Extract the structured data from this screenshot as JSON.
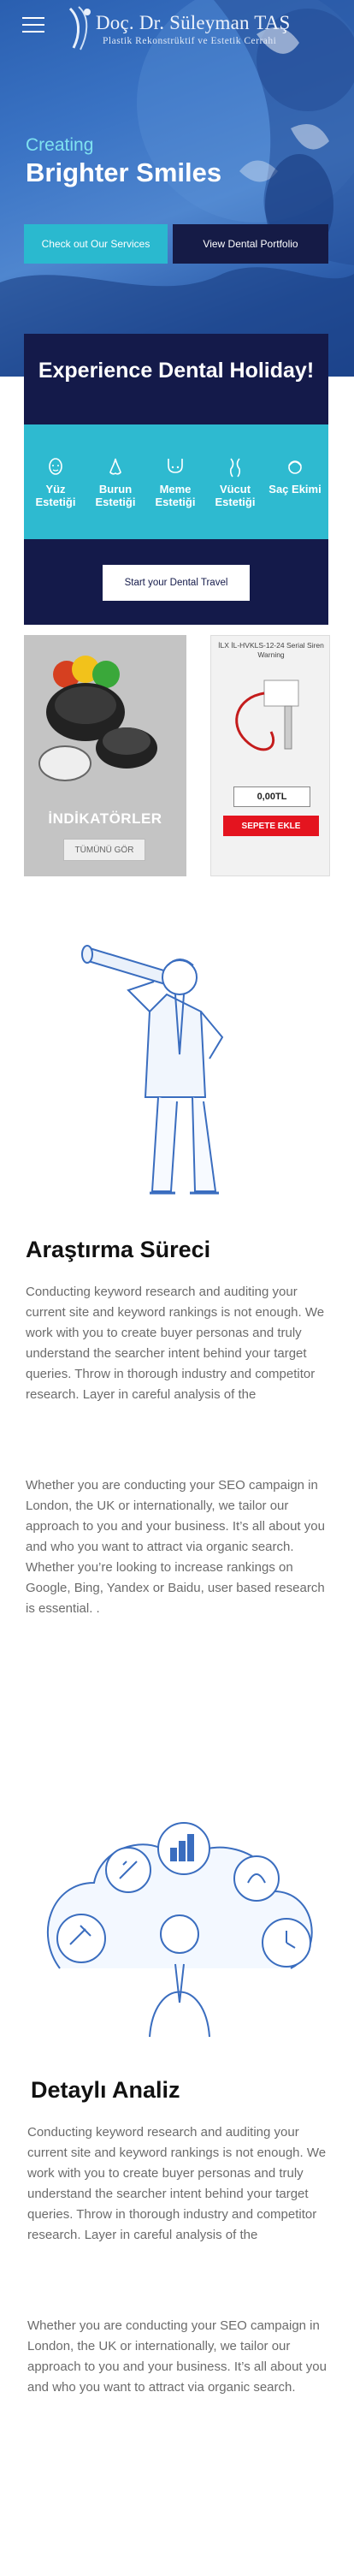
{
  "header": {
    "logo_name": "Doç. Dr. Süleyman TAŞ",
    "logo_subtitle": "Plastik Rekonstrüktif ve Estetik Cerrahi"
  },
  "hero": {
    "tagline_small": "Creating",
    "tagline_big": "Brighter Smiles",
    "btn_services": "Check out Our Services",
    "btn_portfolio": "View Dental Portfolio"
  },
  "holiday": {
    "title": "Experience Dental Holiday!",
    "services": [
      {
        "label": "Yüz Estetiği",
        "icon": "face-icon"
      },
      {
        "label": "Burun Estetiği",
        "icon": "nose-icon"
      },
      {
        "label": "Meme Estetiği",
        "icon": "breast-icon"
      },
      {
        "label": "Vücut Estetiği",
        "icon": "body-icon"
      },
      {
        "label": "Saç Ekimi",
        "icon": "hair-icon"
      }
    ],
    "btn_travel": "Start your Dental Travel"
  },
  "products": {
    "p1_label": "İNDİKATÖRLER",
    "p1_button": "TÜMÜNÜ GÖR",
    "p2_name": "İLX İL-HVKLS-12-24 Serial Siren Warning",
    "p2_price": "0,00TL",
    "p2_button": "SEPETE EKLE"
  },
  "section1": {
    "title": "Araştırma Süreci",
    "para1": "Conducting keyword research and auditing your current site and keyword rankings is not enough. We work with you to create buyer personas and truly understand the searcher intent behind your target queries. Throw in thorough industry and competitor research. Layer in careful analysis of the",
    "para2": "Whether you are conducting your SEO campaign in London, the UK or internationally, we tailor our approach to you and your business. It’s all about you and who you want to attract via organic search. Whether you’re looking to increase rankings on Google, Bing, Yandex or Baidu, user based research is essential. ."
  },
  "section2": {
    "title": "Detaylı Analiz",
    "para1": "Conducting keyword research and auditing your current site and keyword rankings is not enough. We work with you to create buyer personas and truly understand the searcher intent behind your target queries. Throw in thorough industry and competitor research. Layer in careful analysis of the",
    "para2": "Whether you are conducting your SEO campaign in London, the UK or internationally, we tailor our approach to you and your business. It’s all about you and who you want to attract via organic search."
  },
  "colors": {
    "hero_blue": "#3a73c4",
    "teal": "#2ebad0",
    "navy": "#141a4a",
    "red_button": "#e4141f"
  }
}
